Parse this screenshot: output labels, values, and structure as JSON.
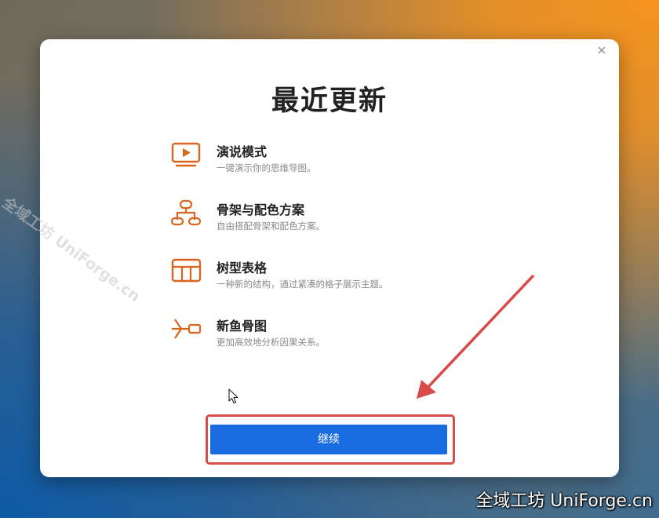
{
  "dialog": {
    "title": "最近更新",
    "features": [
      {
        "icon": "presentation-icon",
        "name": "演说模式",
        "desc": "一键演示你的思维导图。"
      },
      {
        "icon": "skeleton-icon",
        "name": "骨架与配色方案",
        "desc": "自由搭配骨架和配色方案。"
      },
      {
        "icon": "table-icon",
        "name": "树型表格",
        "desc": "一种新的结构，通过紧凑的格子展示主题。"
      },
      {
        "icon": "fishbone-icon",
        "name": "新鱼骨图",
        "desc": "更加高效地分析因果关系。"
      }
    ],
    "continue_label": "继续"
  },
  "watermark": {
    "diagonal": "全域工坊 UniForge.cn",
    "corner": "全域工坊 UniForge.cn"
  },
  "colors": {
    "accent": "#1a6de0",
    "icon": "#d9651e",
    "annotation": "#d94b4b"
  }
}
